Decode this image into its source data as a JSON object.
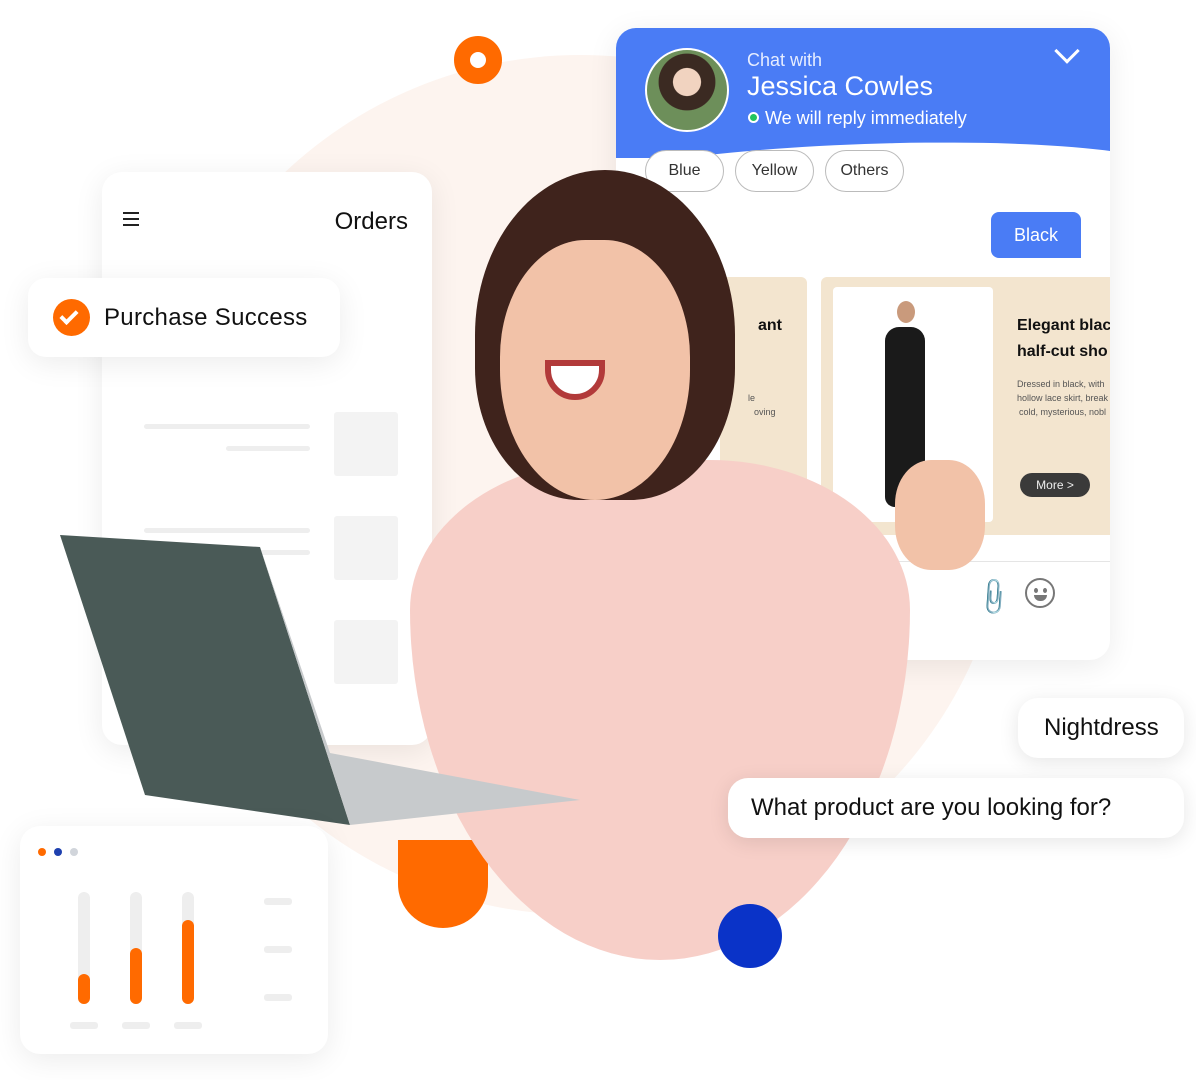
{
  "orders": {
    "menu_icon": "hamburger-icon",
    "title": "Orders"
  },
  "purchase": {
    "icon": "check-circle-icon",
    "label": "Purchase Success"
  },
  "chat": {
    "subtitle": "Chat with",
    "agent_name": "Jessica Cowles",
    "status": "We will reply immediately",
    "status_color": "#22c55e",
    "header_color": "#4a7cf5",
    "chips": [
      "Blue",
      "Yellow",
      "Others"
    ],
    "reply": "Black",
    "product_left": {
      "title_fragment": "ant",
      "desc_fragments": [
        "le",
        "oving"
      ]
    },
    "product": {
      "title_line1": "Elegant blac",
      "title_line2": "half-cut sho",
      "desc": [
        "Dressed in black, with",
        "hollow lace skirt, break",
        "cold, mysterious, nobl"
      ],
      "more": "More >"
    },
    "toolbar_icons": [
      "paperclip-icon",
      "smiley-icon"
    ]
  },
  "bubbles": {
    "reply": "Nightdress",
    "question": "What product are you looking for?"
  },
  "mini_chart": {
    "dots": [
      "#ff6a00",
      "#1e40af",
      "#d1d5db"
    ],
    "levels": [
      0.27,
      0.5,
      0.75
    ],
    "accent": "#ff6a00"
  }
}
